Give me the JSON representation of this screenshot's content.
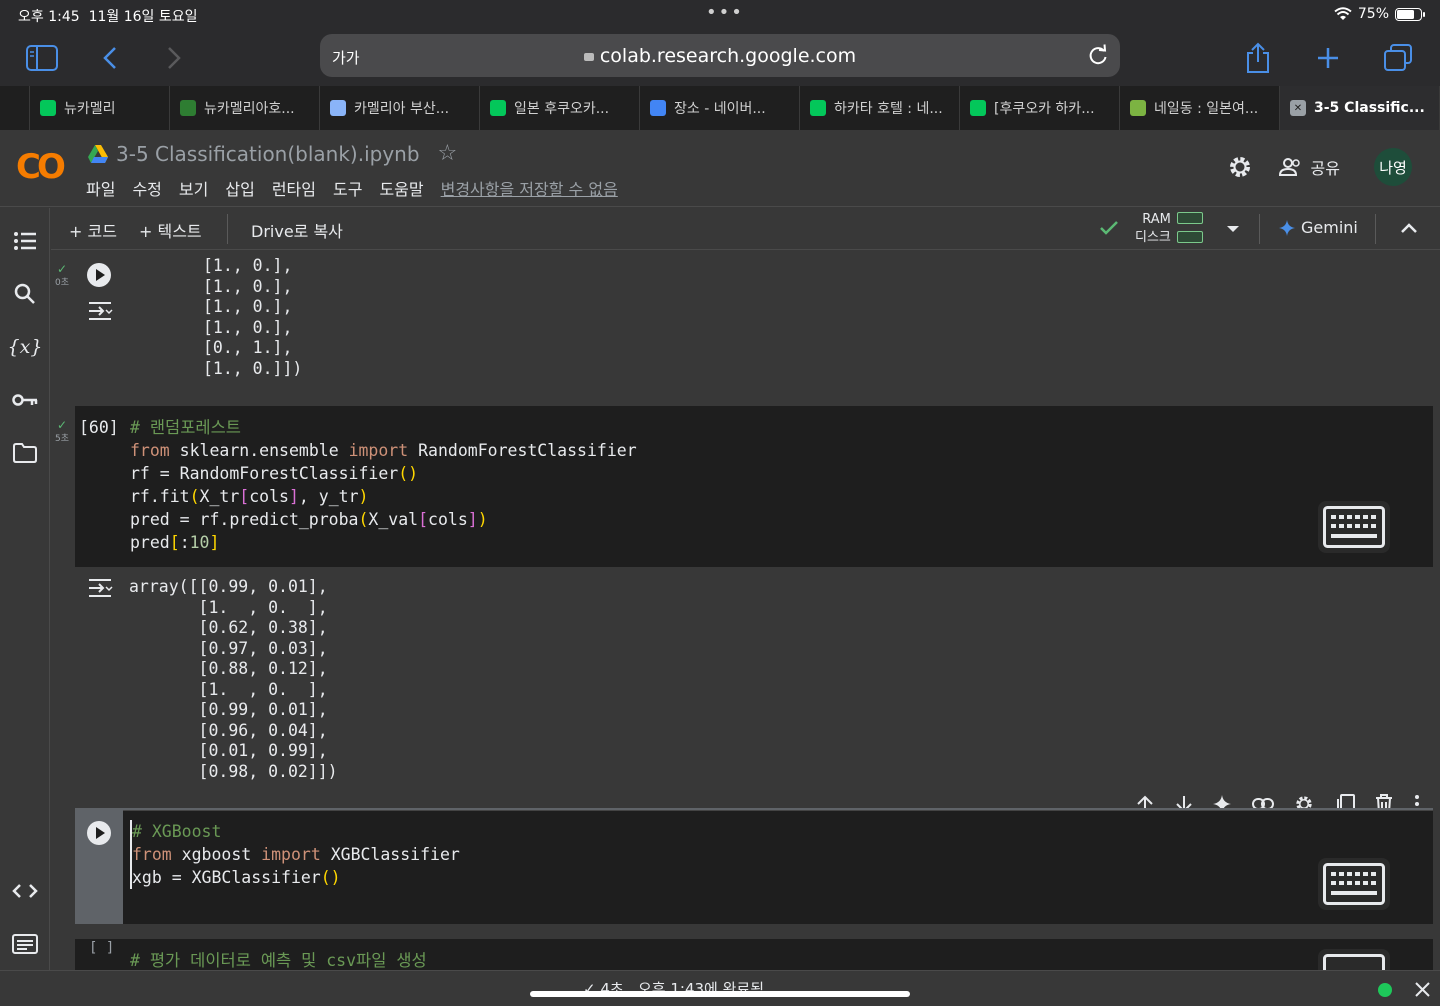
{
  "status_bar": {
    "time": "오후 1:45",
    "date": "11월 16일 토요일",
    "battery": "75%",
    "battery_level": 0.75
  },
  "browser": {
    "text_size_label": "가가",
    "url": "colab.research.google.com"
  },
  "tabs": [
    {
      "label": "뉴카멜리",
      "favicon": "blog-icon",
      "color": "#03c75a"
    },
    {
      "label": "뉴카멜리아호...",
      "favicon": "shield-icon",
      "color": "#2e7d32"
    },
    {
      "label": "카멜리아 부산...",
      "favicon": "location-pin-icon",
      "color": "#8ab4f8"
    },
    {
      "label": "일본 후쿠오카...",
      "favicon": "blog-icon",
      "color": "#03c75a"
    },
    {
      "label": "장소 - 네이버...",
      "favicon": "map-icon",
      "color": "#4285f4"
    },
    {
      "label": "하카타 호텔 : 네...",
      "favicon": "naver-icon",
      "color": "#03c75a"
    },
    {
      "label": "[후쿠오카 하카...",
      "favicon": "blog-icon",
      "color": "#03c75a"
    },
    {
      "label": "네일동 : 일본여...",
      "favicon": "leaf-icon",
      "color": "#7cb342"
    },
    {
      "label": "3-5 Classific...",
      "favicon": "close-icon",
      "color": "#9aa0a6",
      "active": true
    }
  ],
  "colab": {
    "logo": "CO",
    "notebook_title": "3-5 Classification(blank).ipynb",
    "menu": [
      "파일",
      "수정",
      "보기",
      "삽입",
      "런타임",
      "도구",
      "도움말"
    ],
    "unsaved_notice": "변경사항을 저장할 수 없음",
    "share_label": "공유",
    "avatar": "나영"
  },
  "toolbar": {
    "add_code": "+ 코드",
    "add_text": "+ 텍스트",
    "copy_drive": "Drive로 복사",
    "ram_label": "RAM",
    "disk_label": "디스크",
    "gemini": "Gemini"
  },
  "cells": {
    "prev_output": {
      "exec_time": "0초",
      "lines": [
        "[1., 0.],",
        "[1., 0.],",
        "[1., 0.],",
        "[1., 0.],",
        "[0., 1.],",
        "[1., 0.]])"
      ]
    },
    "rf": {
      "exec_count": "[60]",
      "exec_time": "5초",
      "comment": "# 랜덤포레스트",
      "output_lines": [
        "array([[0.99, 0.01],",
        "       [1.  , 0.  ],",
        "       [0.62, 0.38],",
        "       [0.97, 0.03],",
        "       [0.88, 0.12],",
        "       [1.  , 0.  ],",
        "       [0.99, 0.01],",
        "       [0.96, 0.04],",
        "       [0.01, 0.99],",
        "       [0.98, 0.02]])"
      ]
    },
    "xgb": {
      "comment": "# XGBoost"
    },
    "next": {
      "exec_count": "[ ]",
      "comment": "# 평가 데이터로 예측 및 csv파일 생성"
    }
  },
  "bottom": {
    "status": "✓ 4초   오후 1:43에 완료됨"
  }
}
